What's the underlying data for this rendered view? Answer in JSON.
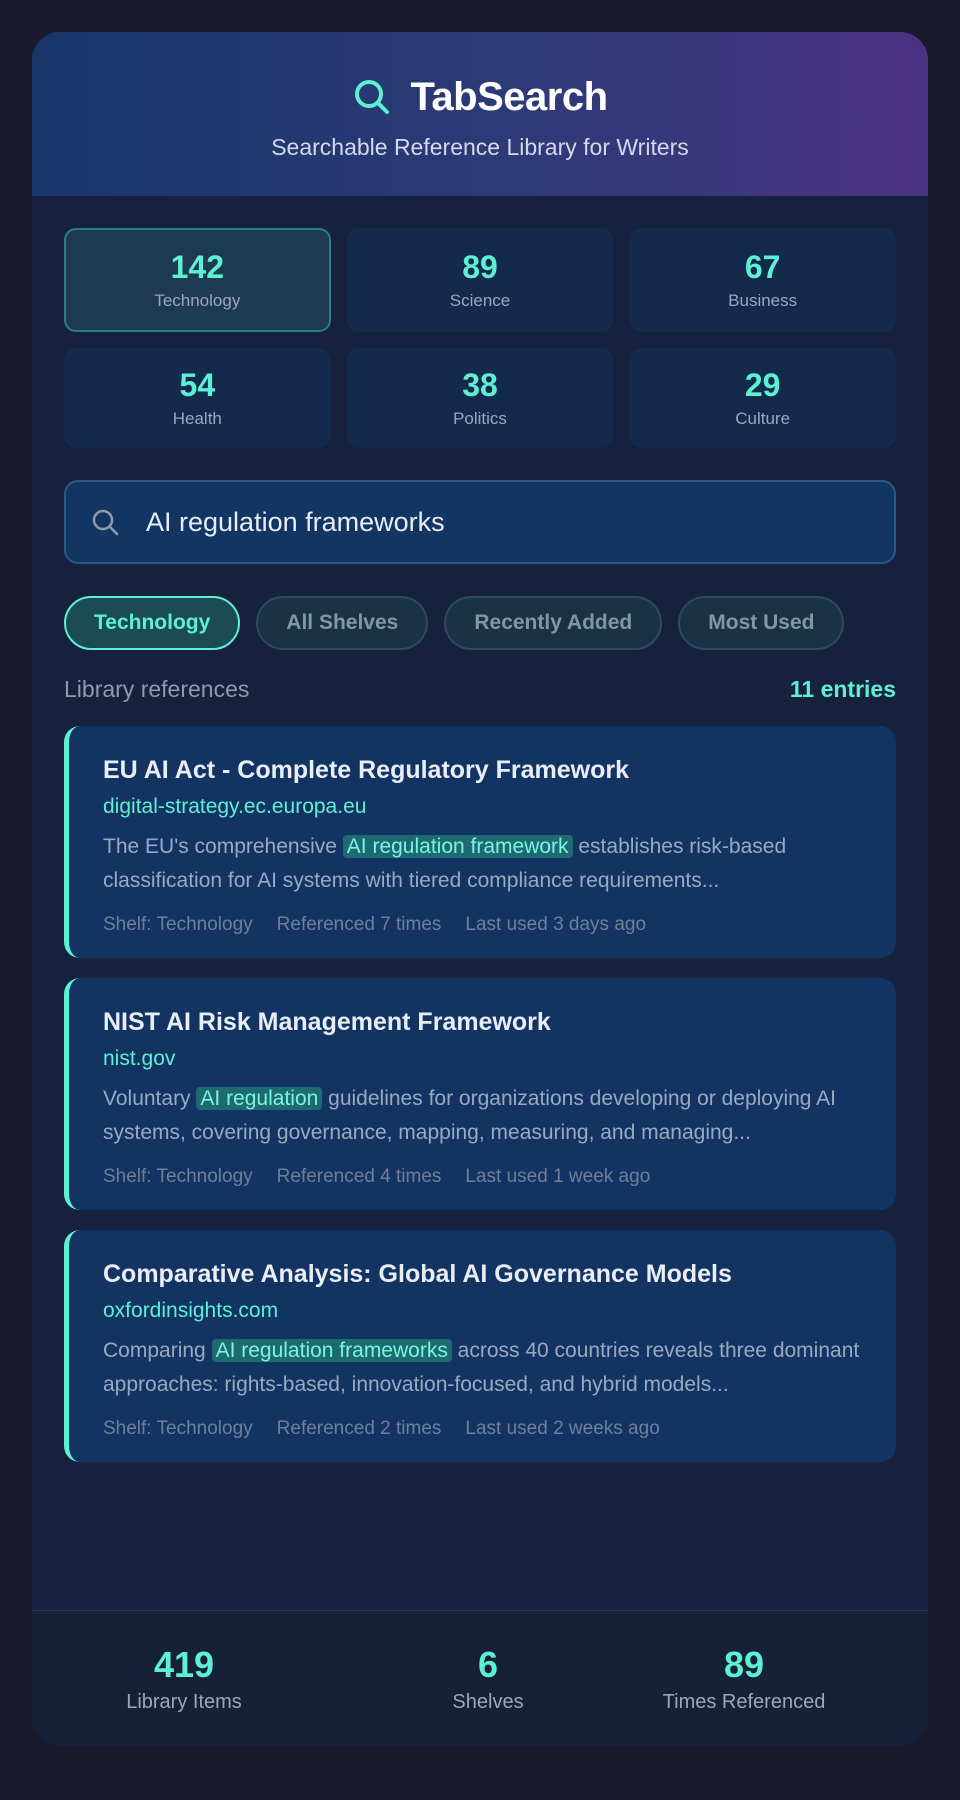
{
  "header": {
    "title": "TabSearch",
    "subtitle": "Searchable Reference Library for Writers"
  },
  "stats": [
    {
      "value": "142",
      "label": "Technology"
    },
    {
      "value": "89",
      "label": "Science"
    },
    {
      "value": "67",
      "label": "Business"
    },
    {
      "value": "54",
      "label": "Health"
    },
    {
      "value": "38",
      "label": "Politics"
    },
    {
      "value": "29",
      "label": "Culture"
    }
  ],
  "search": {
    "value": "AI regulation frameworks"
  },
  "filters": [
    {
      "label": "Technology"
    },
    {
      "label": "All Shelves"
    },
    {
      "label": "Recently Added"
    },
    {
      "label": "Most Used"
    }
  ],
  "results": {
    "section_title": "Library references",
    "count": "11 entries",
    "items": [
      {
        "title": "EU AI Act - Complete Regulatory Framework",
        "url": "digital-strategy.ec.europa.eu",
        "snippet_before": "The EU's comprehensive ",
        "snippet_highlight": "AI regulation framework",
        "snippet_after": " establishes risk-based classification for AI systems with tiered compliance requirements...",
        "shelf": "Shelf: Technology",
        "referenced": "Referenced 7 times",
        "last_used": "Last used 3 days ago"
      },
      {
        "title": "NIST AI Risk Management Framework",
        "url": "nist.gov",
        "snippet_before": "Voluntary ",
        "snippet_highlight": "AI regulation",
        "snippet_after": " guidelines for organizations developing or deploying AI systems, covering governance, mapping, measuring, and managing...",
        "shelf": "Shelf: Technology",
        "referenced": "Referenced 4 times",
        "last_used": "Last used 1 week ago"
      },
      {
        "title": "Comparative Analysis: Global AI Governance Models",
        "url": "oxfordinsights.com",
        "snippet_before": "Comparing ",
        "snippet_highlight": "AI regulation frameworks",
        "snippet_after": " across 40 countries reveals three dominant approaches: rights-based, innovation-focused, and hybrid models...",
        "shelf": "Shelf: Technology",
        "referenced": "Referenced 2 times",
        "last_used": "Last used 2 weeks ago"
      }
    ]
  },
  "footer": [
    {
      "value": "419",
      "label": "Library Items"
    },
    {
      "value": "6",
      "label": "Shelves"
    },
    {
      "value": "89",
      "label": "Times Referenced"
    }
  ],
  "colors": {
    "accent": "#5df0d2",
    "background": "#16213d",
    "card": "#133463"
  },
  "icons": {
    "logo": "search-icon",
    "search_field": "search-icon"
  }
}
